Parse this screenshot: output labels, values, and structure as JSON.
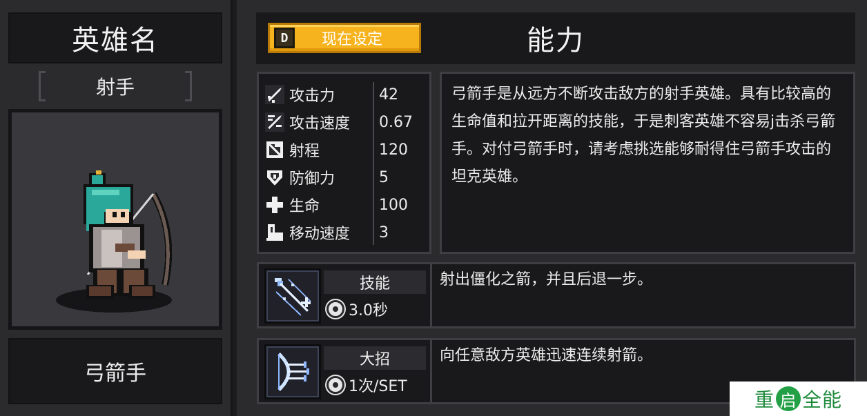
{
  "hero_panel": {
    "title": "英雄名",
    "class_label": "射手",
    "hero_name": "弓箭手"
  },
  "header": {
    "set_button": {
      "key": "D",
      "label": "现在设定"
    },
    "title": "能力"
  },
  "stats": [
    {
      "icon": "sword-attack-icon",
      "label": "攻击力",
      "value": "42"
    },
    {
      "icon": "attack-speed-icon",
      "label": "攻击速度",
      "value": "0.67"
    },
    {
      "icon": "bow-range-icon",
      "label": "射程",
      "value": "120"
    },
    {
      "icon": "shield-defense-icon",
      "label": "防御力",
      "value": "5"
    },
    {
      "icon": "health-cross-icon",
      "label": "生命",
      "value": "100"
    },
    {
      "icon": "boot-speed-icon",
      "label": "移动速度",
      "value": "3"
    }
  ],
  "description": "弓箭手是从远方不断攻击敌方的射手英雄。具有比较高的生命值和拉开距离的技能，于是刺客英雄不容易j击杀弓箭手。对付弓箭手时，请考虑挑选能够耐得住弓箭手攻击的坦克英雄。",
  "skill": {
    "icon": "ice-arrow-skill-icon",
    "name": "技能",
    "cooldown": "3.0秒",
    "description": "射出僵化之箭，并且后退一步。"
  },
  "ultimate": {
    "icon": "arrow-volley-ultimate-icon",
    "name": "大招",
    "usage": "1次/SET",
    "description": "向任意敌方英雄迅速连续射箭。"
  },
  "watermark": {
    "left": "重",
    "seal": "启",
    "right": "全能"
  },
  "colors": {
    "accent_button": "#f6b31d",
    "panel": "#2b2b2e",
    "box": "#19191b"
  }
}
